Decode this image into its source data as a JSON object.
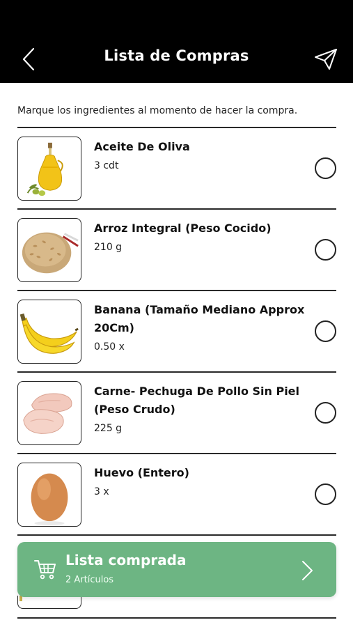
{
  "header": {
    "title": "Lista de Compras",
    "back_icon": "chevron-left-icon",
    "send_icon": "paper-plane-icon"
  },
  "instruction": "Marque los ingredientes al momento de hacer la compra.",
  "items": [
    {
      "name": "Aceite De Oliva",
      "qty": "3 cdt",
      "image": "olive-oil-bottle",
      "checked": false
    },
    {
      "name": "Arroz Integral (Peso Cocido)",
      "qty": "210 g",
      "image": "brown-rice",
      "checked": false
    },
    {
      "name": "Banana (Tamaño Mediano Approx 20Cm)",
      "qty": "0.50 x",
      "image": "bananas",
      "checked": false
    },
    {
      "name": "Carne- Pechuga De Pollo Sin Piel (Peso Crudo)",
      "qty": "225 g",
      "image": "chicken-breast",
      "checked": false
    },
    {
      "name": "Huevo (Entero)",
      "qty": "3 x",
      "image": "egg",
      "checked": false
    }
  ],
  "purchased_bar": {
    "title": "Lista comprada",
    "subtitle": "2 Artículos",
    "icon": "cart-icon",
    "color": "#6db583"
  },
  "colors": {
    "header_bg": "#000000",
    "accent_green": "#6db583",
    "divider": "#2a2a2a"
  }
}
